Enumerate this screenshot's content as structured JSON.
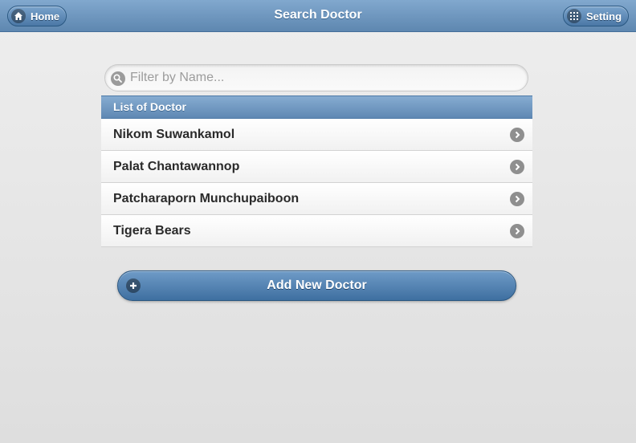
{
  "header": {
    "title": "Search Doctor",
    "home_label": "Home",
    "setting_label": "Setting"
  },
  "search": {
    "placeholder": "Filter by Name...",
    "value": ""
  },
  "list": {
    "divider": "List of Doctor",
    "items": [
      {
        "name": "Nikom Suwankamol"
      },
      {
        "name": "Palat Chantawannop"
      },
      {
        "name": "Patcharaporn Munchupaiboon"
      },
      {
        "name": "Tigera Bears"
      }
    ]
  },
  "actions": {
    "add_label": "Add New Doctor"
  },
  "icons": {
    "home": "home-icon",
    "setting": "grid-icon",
    "search": "search-icon",
    "arrow": "chevron-right-icon",
    "add": "plus-icon"
  },
  "colors": {
    "header_bar": "#6d95bd",
    "button_blue": "#4f7eae",
    "background": "#e6e6e6",
    "text_dark": "#2a2a2a"
  }
}
